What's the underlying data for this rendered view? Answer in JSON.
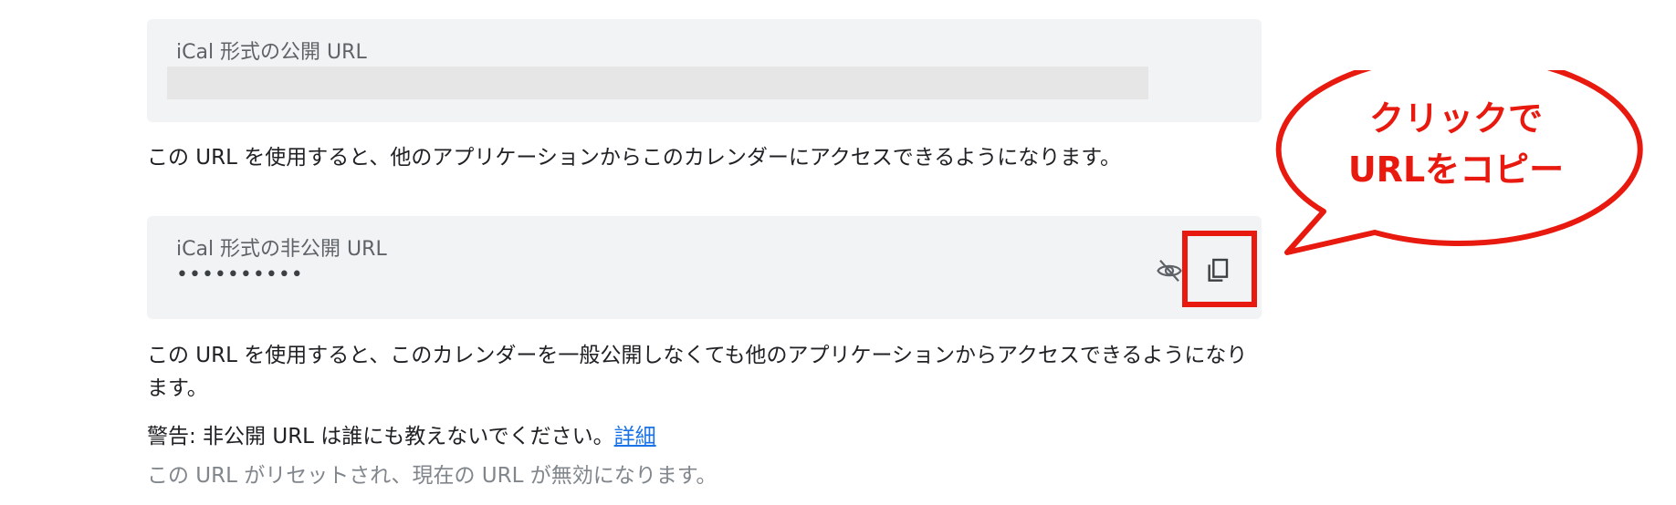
{
  "public_url": {
    "label": "iCal 形式の公開 URL",
    "description": "この URL を使用すると、他のアプリケーションからこのカレンダーにアクセスできるようになります。"
  },
  "private_url": {
    "label": "iCal 形式の非公開 URL",
    "masked_value": "••••••••••",
    "description": "この URL を使用すると、このカレンダーを一般公開しなくても他のアプリケーションからアクセスできるようになります。",
    "show_icon": "eye-off-icon",
    "copy_icon": "copy-icon"
  },
  "warning": {
    "text": "警告: 非公開 URL は誰にも教えないでください。",
    "link": "詳細"
  },
  "reset_note": "この URL がリセットされ、現在の URL が無効になります。",
  "callout": {
    "line1": "クリックで",
    "line2": "URLをコピー",
    "color": "#e8190e"
  }
}
